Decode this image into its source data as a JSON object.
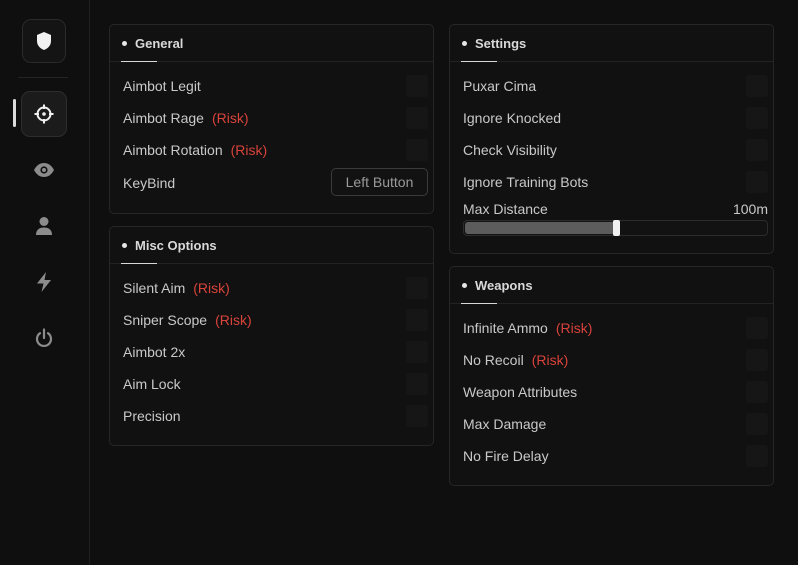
{
  "sidebar": {
    "logo_icon": "shield-icon",
    "items": [
      {
        "icon": "crosshair-icon",
        "active": true
      },
      {
        "icon": "eye-icon",
        "active": false
      },
      {
        "icon": "user-icon",
        "active": false
      },
      {
        "icon": "bolt-icon",
        "active": false
      },
      {
        "icon": "power-icon",
        "active": false
      }
    ]
  },
  "panels": {
    "general": {
      "title": "General",
      "rows": [
        {
          "label": "Aimbot Legit"
        },
        {
          "label": "Aimbot Rage",
          "risk": "(Risk)"
        },
        {
          "label": "Aimbot Rotation",
          "risk": "(Risk)"
        }
      ],
      "keybind": {
        "label": "KeyBind",
        "value": "Left Button"
      }
    },
    "misc": {
      "title": "Misc Options",
      "rows": [
        {
          "label": "Silent Aim",
          "risk": "(Risk)"
        },
        {
          "label": "Sniper Scope",
          "risk": "(Risk)"
        },
        {
          "label": "Aimbot 2x"
        },
        {
          "label": "Aim Lock"
        },
        {
          "label": "Precision"
        }
      ]
    },
    "settings": {
      "title": "Settings",
      "rows": [
        {
          "label": "Puxar Cima"
        },
        {
          "label": "Ignore Knocked"
        },
        {
          "label": "Check Visibility"
        },
        {
          "label": "Ignore Training Bots"
        }
      ],
      "slider": {
        "label": "Max Distance",
        "value_text": "100m",
        "fraction": 0.5
      }
    },
    "weapons": {
      "title": "Weapons",
      "rows": [
        {
          "label": "Infinite Ammo",
          "risk": "(Risk)"
        },
        {
          "label": "No Recoil",
          "risk": "(Risk)"
        },
        {
          "label": "Weapon Attributes"
        },
        {
          "label": "Max Damage"
        },
        {
          "label": "No Fire Delay"
        }
      ]
    }
  },
  "colors": {
    "risk": "#d9433b",
    "accent": "#f0f0f0"
  }
}
